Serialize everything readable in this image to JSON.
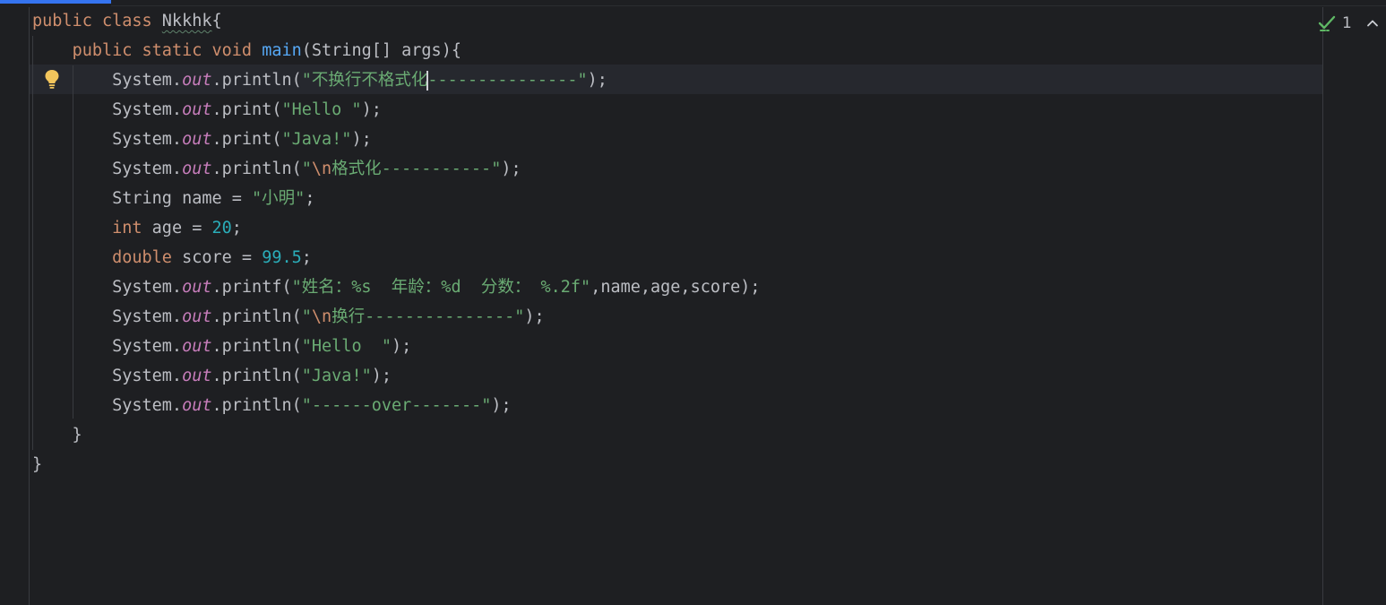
{
  "editor": {
    "lines": [
      [
        {
          "t": "public ",
          "c": "kw"
        },
        {
          "t": "class ",
          "c": "kw"
        },
        {
          "t": "Nkkhk",
          "c": "cls"
        },
        {
          "t": "{",
          "c": ""
        }
      ],
      [
        {
          "t": "    ",
          "c": ""
        },
        {
          "t": "public ",
          "c": "kw"
        },
        {
          "t": "static ",
          "c": "kw"
        },
        {
          "t": "void ",
          "c": "kw"
        },
        {
          "t": "main",
          "c": "fn"
        },
        {
          "t": "(String[] args){",
          "c": ""
        }
      ],
      [
        {
          "t": "        System.",
          "c": ""
        },
        {
          "t": "out",
          "c": "field"
        },
        {
          "t": ".println(",
          "c": ""
        },
        {
          "t": "\"不换行不格式化",
          "c": "str"
        },
        {
          "t": "",
          "c": "caret"
        },
        {
          "t": "---------------\"",
          "c": "str"
        },
        {
          "t": ");",
          "c": ""
        }
      ],
      [
        {
          "t": "        System.",
          "c": ""
        },
        {
          "t": "out",
          "c": "field"
        },
        {
          "t": ".print(",
          "c": ""
        },
        {
          "t": "\"Hello \"",
          "c": "str"
        },
        {
          "t": ");",
          "c": ""
        }
      ],
      [
        {
          "t": "        System.",
          "c": ""
        },
        {
          "t": "out",
          "c": "field"
        },
        {
          "t": ".print(",
          "c": ""
        },
        {
          "t": "\"Java!\"",
          "c": "str"
        },
        {
          "t": ");",
          "c": ""
        }
      ],
      [
        {
          "t": "        System.",
          "c": ""
        },
        {
          "t": "out",
          "c": "field"
        },
        {
          "t": ".println(",
          "c": ""
        },
        {
          "t": "\"",
          "c": "str"
        },
        {
          "t": "\\n",
          "c": "esc"
        },
        {
          "t": "格式化-----------\"",
          "c": "str"
        },
        {
          "t": ");",
          "c": ""
        }
      ],
      [
        {
          "t": "        String name = ",
          "c": ""
        },
        {
          "t": "\"小明\"",
          "c": "str"
        },
        {
          "t": ";",
          "c": ""
        }
      ],
      [
        {
          "t": "        ",
          "c": ""
        },
        {
          "t": "int ",
          "c": "kw"
        },
        {
          "t": "age = ",
          "c": ""
        },
        {
          "t": "20",
          "c": "num"
        },
        {
          "t": ";",
          "c": ""
        }
      ],
      [
        {
          "t": "        ",
          "c": ""
        },
        {
          "t": "double ",
          "c": "kw"
        },
        {
          "t": "score = ",
          "c": ""
        },
        {
          "t": "99.5",
          "c": "num"
        },
        {
          "t": ";",
          "c": ""
        }
      ],
      [
        {
          "t": "        System.",
          "c": ""
        },
        {
          "t": "out",
          "c": "field"
        },
        {
          "t": ".printf(",
          "c": ""
        },
        {
          "t": "\"姓名：%s  年龄：%d  分数： %.2f\"",
          "c": "str"
        },
        {
          "t": ",name,age,score);",
          "c": ""
        }
      ],
      [
        {
          "t": "        System.",
          "c": ""
        },
        {
          "t": "out",
          "c": "field"
        },
        {
          "t": ".println(",
          "c": ""
        },
        {
          "t": "\"",
          "c": "str"
        },
        {
          "t": "\\n",
          "c": "esc"
        },
        {
          "t": "换行---------------\"",
          "c": "str"
        },
        {
          "t": ");",
          "c": ""
        }
      ],
      [
        {
          "t": "        System.",
          "c": ""
        },
        {
          "t": "out",
          "c": "field"
        },
        {
          "t": ".println(",
          "c": ""
        },
        {
          "t": "\"Hello  \"",
          "c": "str"
        },
        {
          "t": ");",
          "c": ""
        }
      ],
      [
        {
          "t": "        System.",
          "c": ""
        },
        {
          "t": "out",
          "c": "field"
        },
        {
          "t": ".println(",
          "c": ""
        },
        {
          "t": "\"Java!\"",
          "c": "str"
        },
        {
          "t": ");",
          "c": ""
        }
      ],
      [
        {
          "t": "        System.",
          "c": ""
        },
        {
          "t": "out",
          "c": "field"
        },
        {
          "t": ".println(",
          "c": ""
        },
        {
          "t": "\"------over-------\"",
          "c": "str"
        },
        {
          "t": ");",
          "c": ""
        }
      ],
      [
        {
          "t": "    }",
          "c": ""
        }
      ],
      [
        {
          "t": "}",
          "c": ""
        }
      ]
    ]
  },
  "inspections": {
    "count": "1",
    "icon": "check-icon",
    "collapse_icon": "chevron-up-icon"
  },
  "gutter": {
    "intention_icon": "lightbulb-icon"
  },
  "colors": {
    "background": "#1e1f22",
    "keyword": "#cf8e6d",
    "string": "#6aab73",
    "number": "#2aacb8",
    "static_field": "#c77dbb",
    "method_decl": "#56a8f5",
    "default_text": "#bcbec4",
    "accent": "#3574f0"
  }
}
